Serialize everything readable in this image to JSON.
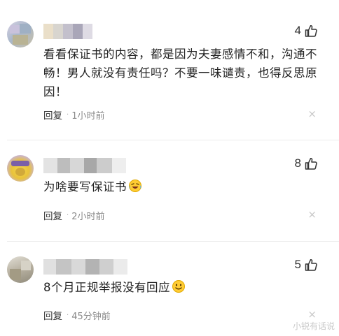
{
  "comments": [
    {
      "likes": "4",
      "text": "看看保证书的内容，都是因为夫妻感情不和，沟通不畅！男人就没有责任吗？不要一味谴责，也得反思原因！",
      "reply_label": "回复",
      "time": "1小时前",
      "close_glyph": "×"
    },
    {
      "likes": "8",
      "text": "为啥要写保证书",
      "emoji_icon": "laughing-crying-emoji-icon",
      "reply_label": "回复",
      "time": "2小时前",
      "close_glyph": "×"
    },
    {
      "likes": "5",
      "text": "8个月正规举报没有回应",
      "emoji_icon": "smiling-emoji-icon",
      "reply_label": "回复",
      "time": "45分钟前",
      "close_glyph": "×"
    }
  ],
  "separator": "·",
  "watermark": "小锐有话说",
  "colors": {
    "text": "#222222",
    "meta": "#8a8a8a",
    "close": "#c8c8c8",
    "divider": "#ececec"
  }
}
